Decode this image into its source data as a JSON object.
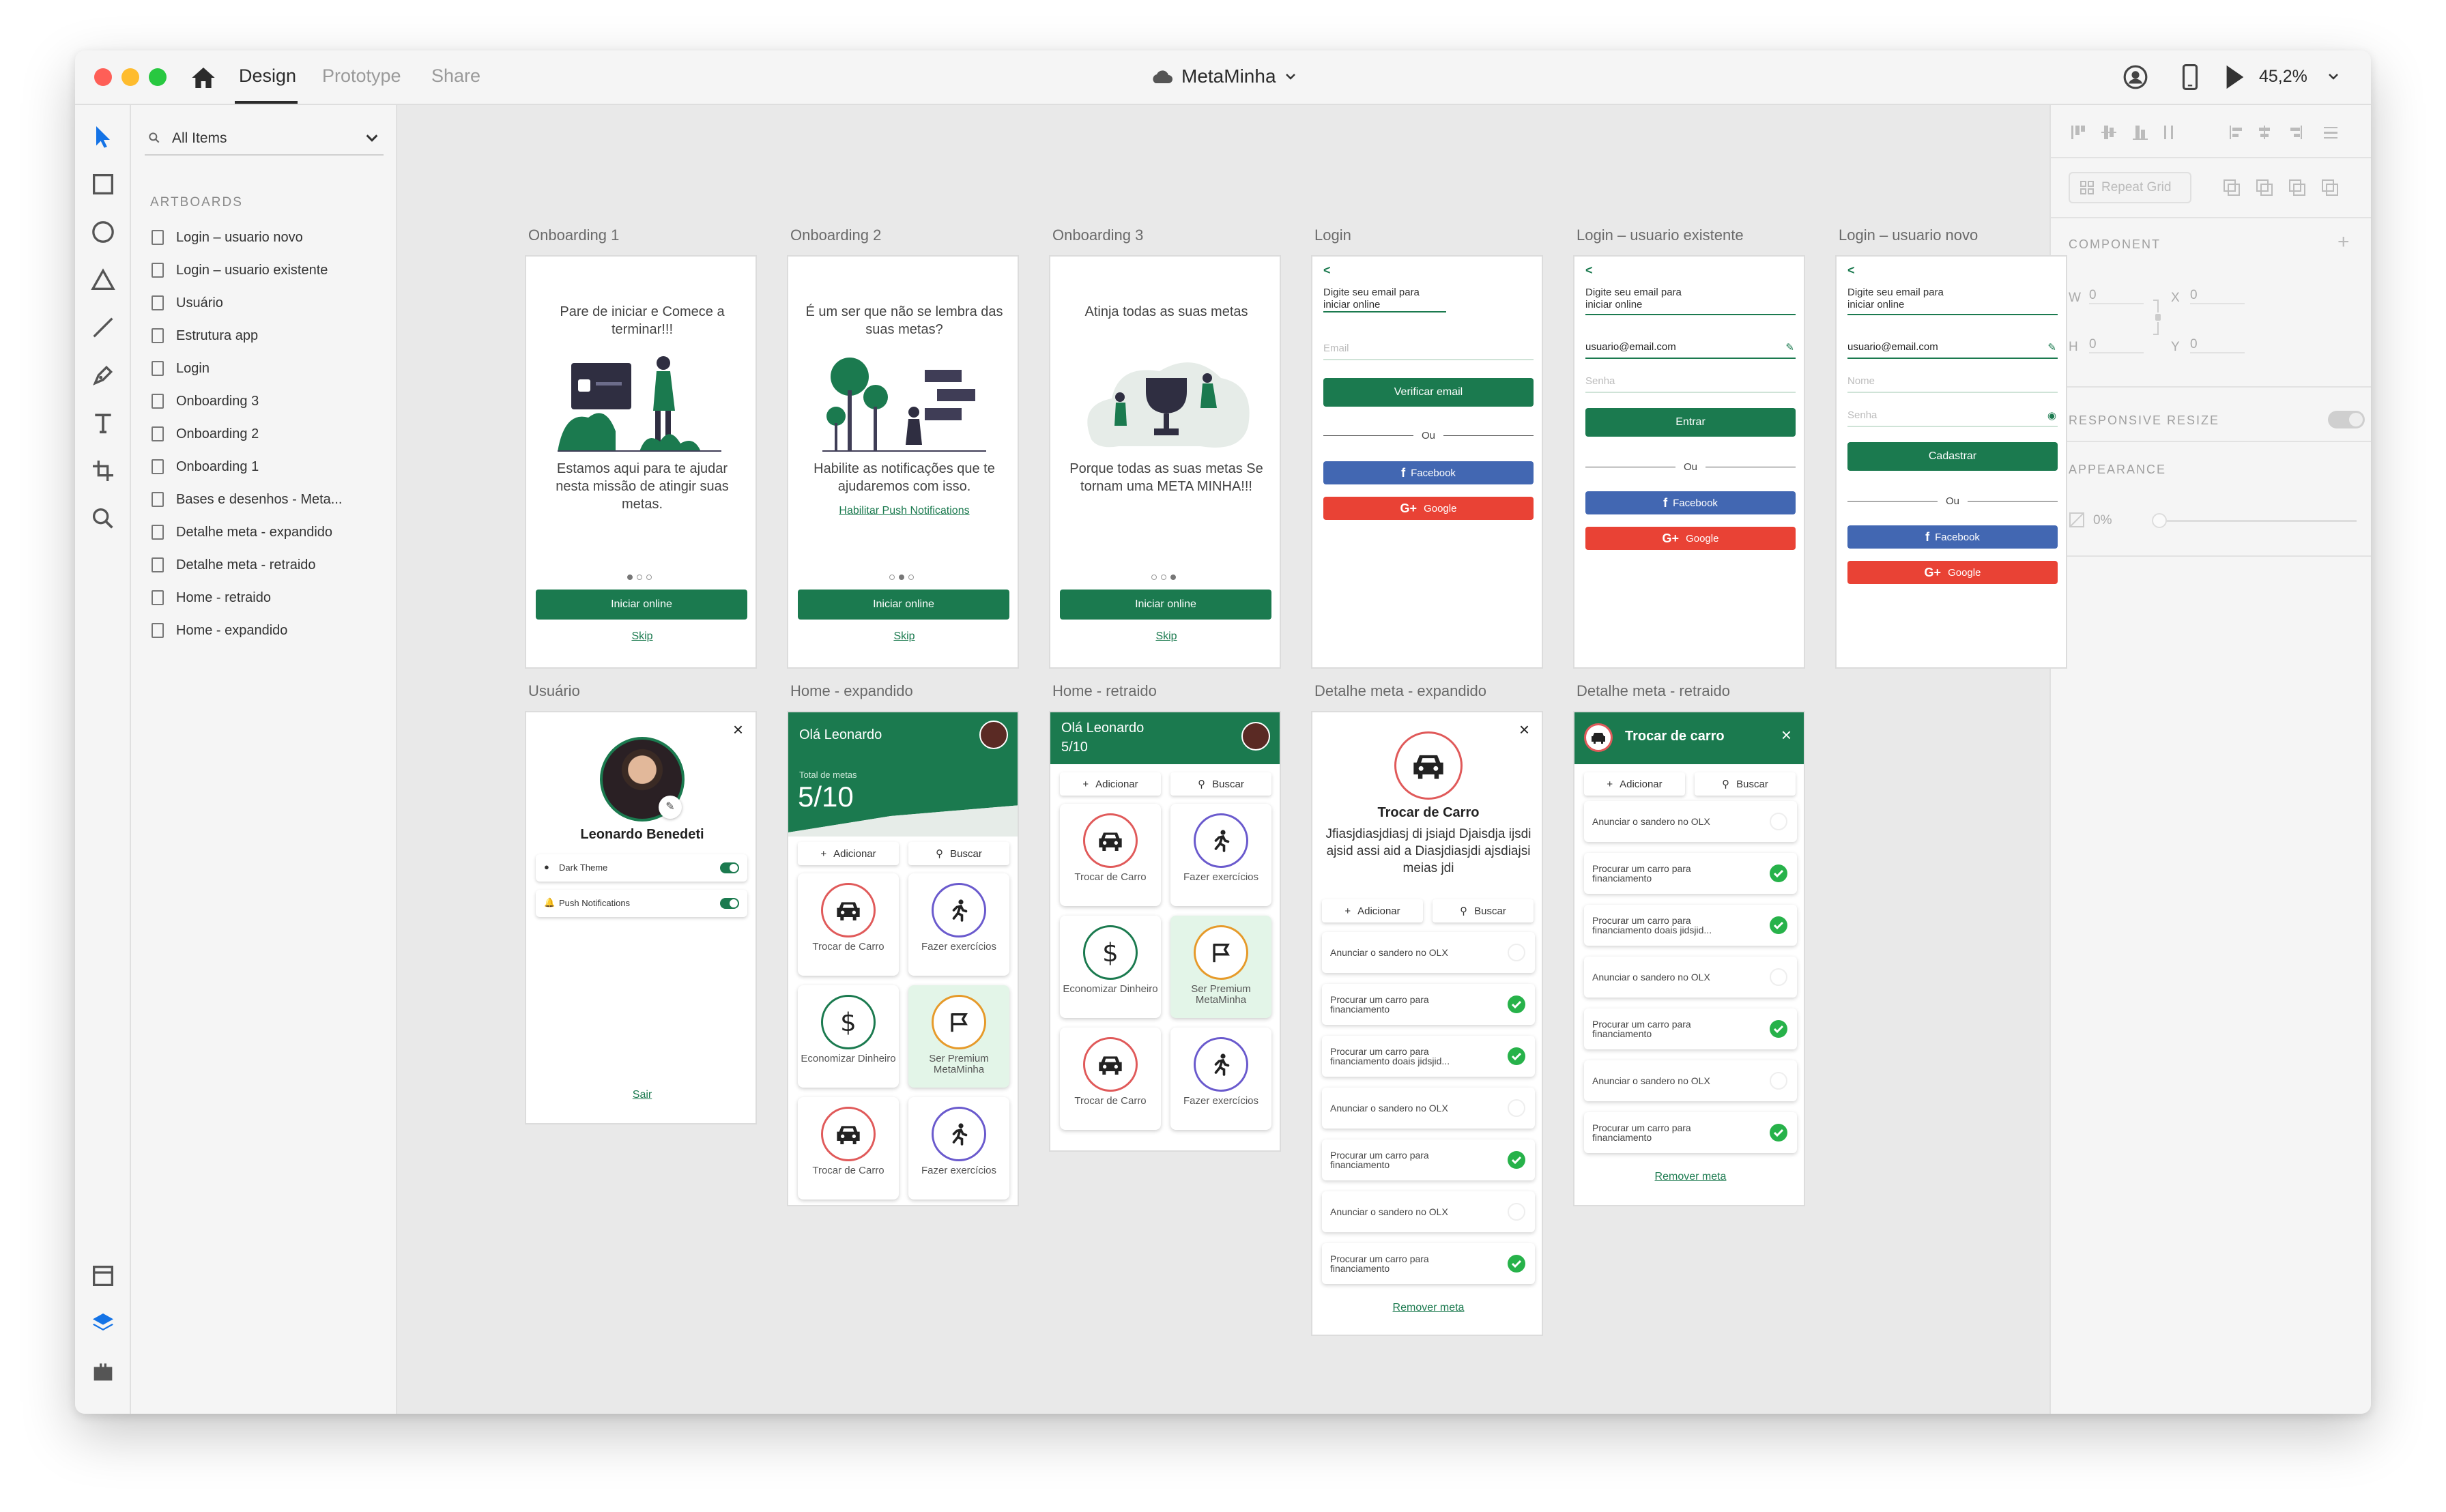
{
  "app": {
    "title": "MetaMinha",
    "tabs": [
      "Design",
      "Prototype",
      "Share"
    ],
    "zoom": "45,2%"
  },
  "layers": {
    "search_label": "All Items",
    "section_label": "ARTBOARDS",
    "items": [
      "Login – usuario novo",
      "Login – usuario existente",
      "Usuário",
      "Estrutura app",
      "Login",
      "Onboarding 3",
      "Onboarding 2",
      "Onboarding 1",
      "Bases e desenhos - Meta...",
      "Detalhe meta - expandido",
      "Detalhe meta - retraido",
      "Home - retraido",
      "Home - expandido"
    ]
  },
  "props": {
    "repeat_grid": "Repeat Grid",
    "component": "COMPONENT",
    "w_label": "W",
    "w_val": "0",
    "x_label": "X",
    "x_val": "0",
    "h_label": "H",
    "h_val": "0",
    "y_label": "Y",
    "y_val": "0",
    "responsive": "RESPONSIVE RESIZE",
    "appearance": "APPEARANCE",
    "opacity": "0%"
  },
  "artboards": {
    "ob1": {
      "title": "Onboarding 1",
      "headline": "Pare de iniciar e Comece a terminar!!!",
      "body": "Estamos aqui para te ajudar nesta missão de atingir suas metas.",
      "button": "Iniciar online",
      "skip": "Skip"
    },
    "ob2": {
      "title": "Onboarding 2",
      "headline": "É um ser que não se lembra das suas metas?",
      "body": "Habilite as notificações que te ajudaremos com isso.",
      "link": "Habilitar Push Notifications",
      "button": "Iniciar online",
      "skip": "Skip"
    },
    "ob3": {
      "title": "Onboarding 3",
      "headline": "Atinja todas as suas metas",
      "body": "Porque todas as suas metas Se tornam uma META MINHA!!!",
      "button": "Iniciar online",
      "skip": "Skip"
    },
    "login": {
      "title": "Login",
      "back": "<",
      "prompt": "Digite seu email para iniciar online",
      "email_ph": "Email",
      "button": "Verificar email",
      "or": "Ou",
      "facebook": "Facebook",
      "google": "Google"
    },
    "login_exist": {
      "title": "Login – usuario existente",
      "back": "<",
      "prompt": "Digite seu email para iniciar online",
      "email": "usuario@email.com",
      "senha_ph": "Senha",
      "button": "Entrar",
      "or": "Ou",
      "facebook": "Facebook",
      "google": "Google"
    },
    "login_new": {
      "title": "Login – usuario novo",
      "back": "<",
      "prompt": "Digite seu email para iniciar online",
      "email": "usuario@email.com",
      "nome_ph": "Nome",
      "senha_ph": "Senha",
      "button": "Cadastrar",
      "or": "Ou",
      "facebook": "Facebook",
      "google": "Google"
    },
    "usuario": {
      "title": "Usuário",
      "name": "Leonardo Benedeti",
      "dark_theme": "Dark Theme",
      "push": "Push Notifications",
      "logout": "Sair",
      "close": "×"
    },
    "home_exp": {
      "title": "Home - expandido",
      "greeting": "Olá Leonardo",
      "total_label": "Total de metas",
      "total": "5/10",
      "add": "Adicionar",
      "search": "Buscar",
      "cards": [
        "Trocar de Carro",
        "Fazer exercícios",
        "Economizar Dinheiro",
        "Ser Premium MetaMinha",
        "Trocar de Carro",
        "Fazer exercícios"
      ]
    },
    "home_ret": {
      "title": "Home - retraido",
      "greeting": "Olá Leonardo",
      "total": "5/10",
      "add": "Adicionar",
      "search": "Buscar",
      "cards": [
        "Trocar de Carro",
        "Fazer exercícios",
        "Economizar Dinheiro",
        "Ser Premium MetaMinha",
        "Trocar de Carro",
        "Fazer exercícios"
      ]
    },
    "det_exp": {
      "title": "Detalhe meta - expandido",
      "goal": "Trocar de Carro",
      "desc": "Jfiasjdiasjdiasj di jsiajd Djaisdja ijsdi ajsid assi aid a Diasjdiasjdi ajsdiajsi meias jdi",
      "add": "Adicionar",
      "search": "Buscar",
      "tasks": [
        "Anunciar o sandero no OLX",
        "Procurar um carro para financiamento",
        "Procurar um carro para financiamento doais jidsjid...",
        "Anunciar o sandero no OLX",
        "Procurar um carro para financiamento",
        "Anunciar o sandero no OLX",
        "Procurar um carro para financiamento"
      ],
      "remove": "Remover meta",
      "close": "×"
    },
    "det_ret": {
      "title": "Detalhe meta - retraido",
      "goal": "Trocar de carro",
      "add": "Adicionar",
      "search": "Buscar",
      "tasks": [
        "Anunciar o sandero no OLX",
        "Procurar um carro para financiamento",
        "Procurar um carro para financiamento doais jidsjid...",
        "Anunciar o sandero no OLX",
        "Procurar um carro para financiamento",
        "Anunciar o sandero no OLX",
        "Procurar um carro para financiamento"
      ],
      "remove": "Remover meta",
      "close": "×"
    }
  },
  "colors": {
    "accent": "#1b7a4f",
    "facebook": "#4267b2",
    "google": "#e94235",
    "check": "#27b24a"
  }
}
